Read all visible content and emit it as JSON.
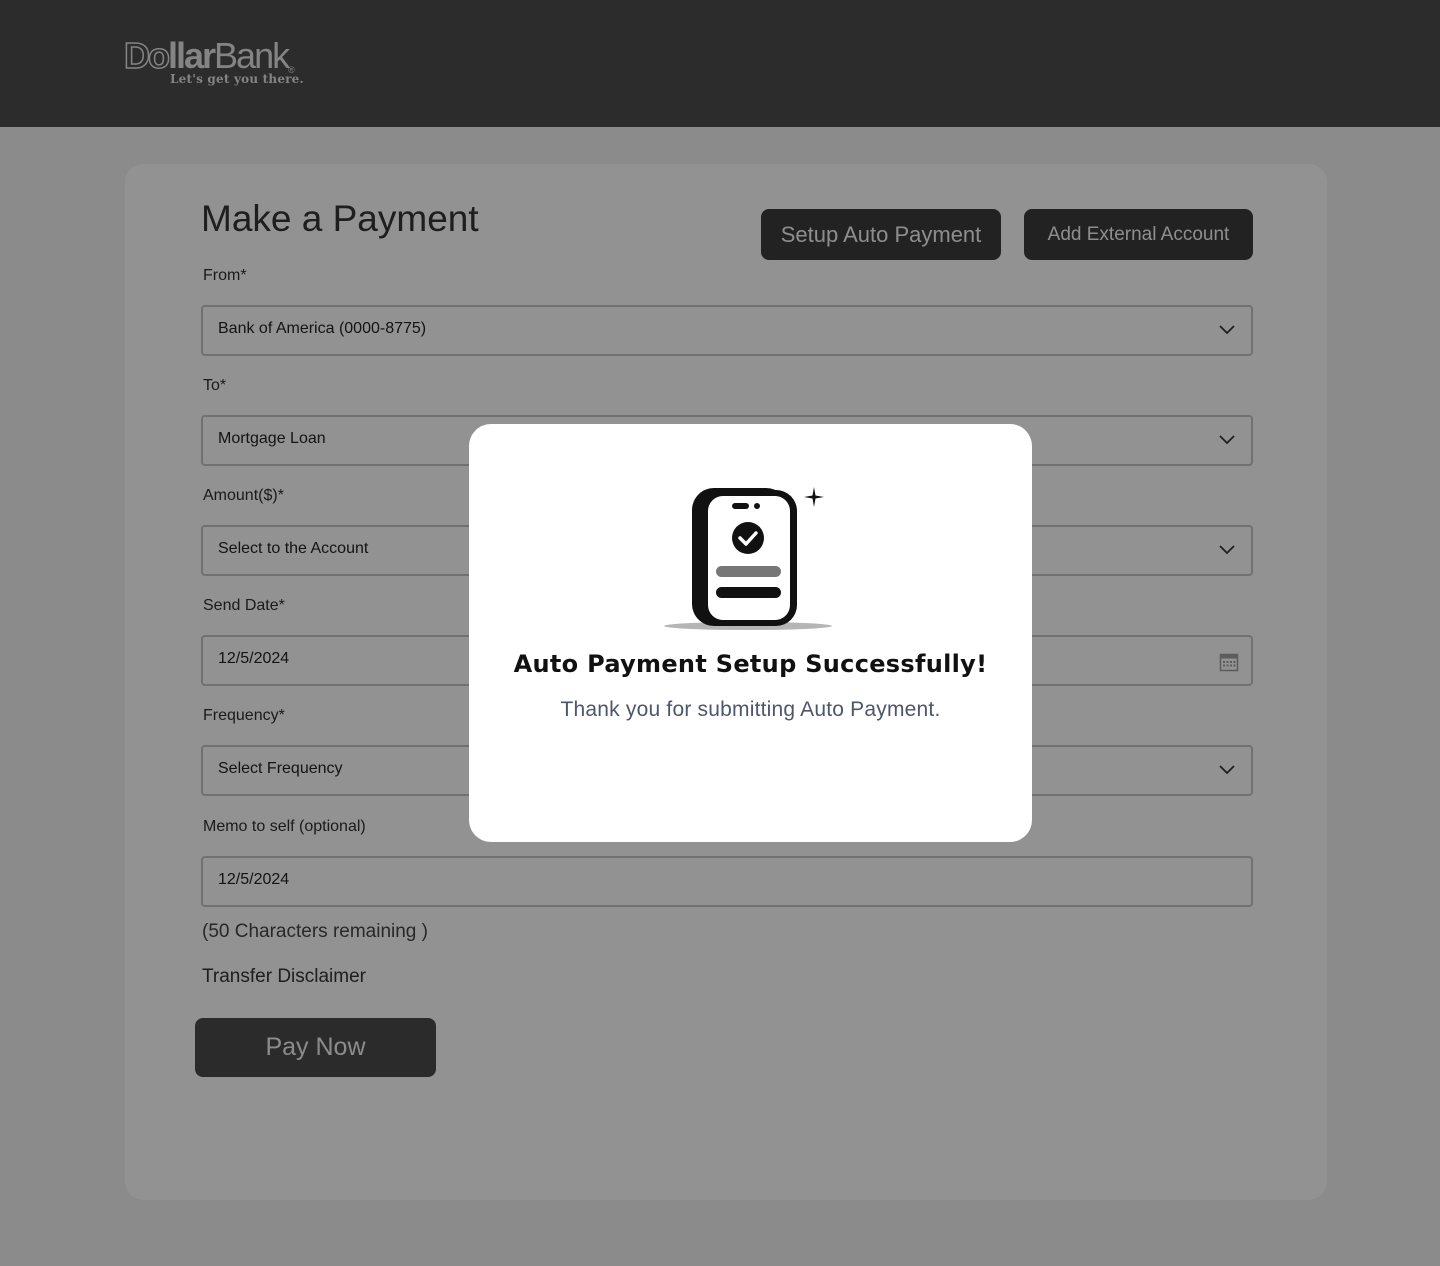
{
  "header": {
    "logo_text": {
      "part1": "Do",
      "part2": "llar",
      "part3": "Bank",
      "registered": "®"
    },
    "tagline": "Let's get you there."
  },
  "page": {
    "title": "Make a Payment",
    "setup_auto_payment_label": "Setup Auto Payment",
    "add_external_account_label": "Add External Account"
  },
  "form": {
    "from": {
      "label": "From*",
      "value": "Bank of America (0000-8775)"
    },
    "to": {
      "label": "To*",
      "value": "Mortgage Loan"
    },
    "amount": {
      "label": "Amount($)*",
      "value": "Select to the Account"
    },
    "send_date": {
      "label": "Send Date*",
      "value": "12/5/2024"
    },
    "frequency": {
      "label": "Frequency*",
      "value": "Select Frequency"
    },
    "memo": {
      "label": "Memo to self (optional)",
      "value": "12/5/2024"
    },
    "chars_remaining": "(50 Characters remaining )",
    "disclaimer": "Transfer Disclaimer",
    "pay_now_label": "Pay Now"
  },
  "modal": {
    "title": "Auto Payment Setup Successfully!",
    "message": "Thank you for submitting Auto Payment.",
    "illustration_icon": "phone-check-icon"
  },
  "colors": {
    "header_bg": "#4a4a4a",
    "button_dark": "#3a3a3a",
    "overlay": "rgba(0,0,0,0.40)",
    "modal_bg": "#ffffff",
    "modal_text": "#4e566b"
  }
}
